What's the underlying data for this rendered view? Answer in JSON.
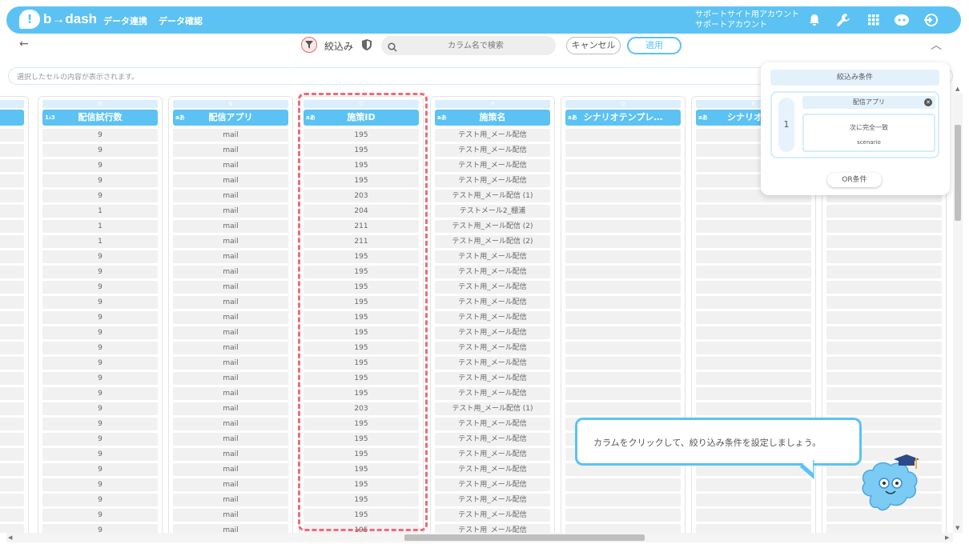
{
  "header": {
    "logo_text": "b→dash",
    "nav": [
      {
        "label": "データ連携"
      },
      {
        "label": "データ確認"
      }
    ],
    "account_line1": "サポートサイト用アカウント",
    "account_line2": "サポートアカウント"
  },
  "toolbar": {
    "back": "←",
    "filter_label": "絞込み",
    "search_placeholder": "カラム名で検索",
    "cancel_label": "キャンセル",
    "apply_label": "適用",
    "collapse": "︿"
  },
  "cellbar": {
    "text": "選択したセルの内容が表示されます。"
  },
  "columns": [
    {
      "letter": "L",
      "type": "",
      "name": "",
      "cells": [
        "",
        "",
        "",
        "",
        "",
        "",
        "",
        "",
        "",
        "",
        "",
        "",
        "",
        "",
        "",
        "",
        "",
        "",
        "",
        "",
        "",
        "",
        "",
        "",
        "",
        "",
        ""
      ]
    },
    {
      "letter": "M",
      "type": "1₂3",
      "name": "配信試行数",
      "cells": [
        "9",
        "9",
        "9",
        "9",
        "9",
        "1",
        "1",
        "1",
        "9",
        "9",
        "9",
        "9",
        "9",
        "9",
        "9",
        "9",
        "9",
        "9",
        "9",
        "9",
        "9",
        "9",
        "9",
        "9",
        "9",
        "9",
        "9"
      ]
    },
    {
      "letter": "N",
      "type": "aあ",
      "name": "配信アプリ",
      "cells": [
        "mail",
        "mail",
        "mail",
        "mail",
        "mail",
        "mail",
        "mail",
        "mail",
        "mail",
        "mail",
        "mail",
        "mail",
        "mail",
        "mail",
        "mail",
        "mail",
        "mail",
        "mail",
        "mail",
        "mail",
        "mail",
        "mail",
        "mail",
        "mail",
        "mail",
        "mail",
        "mail"
      ]
    },
    {
      "letter": "O",
      "type": "aあ",
      "name": "施策ID",
      "cells": [
        "195",
        "195",
        "195",
        "195",
        "203",
        "204",
        "211",
        "211",
        "195",
        "195",
        "195",
        "195",
        "195",
        "195",
        "195",
        "195",
        "195",
        "195",
        "203",
        "195",
        "195",
        "195",
        "195",
        "195",
        "195",
        "195",
        "195"
      ]
    },
    {
      "letter": "P",
      "type": "aあ",
      "name": "施策名",
      "cells": [
        "テスト用_メール配信",
        "テスト用_メール配信",
        "テスト用_メール配信",
        "テスト用_メール配信",
        "テスト用_メール配信 (1)",
        "テストメール2_棚浦",
        "テスト用_メール配信 (2)",
        "テスト用_メール配信 (2)",
        "テスト用_メール配信",
        "テスト用_メール配信",
        "テスト用_メール配信",
        "テスト用_メール配信",
        "テスト用_メール配信",
        "テスト用_メール配信",
        "テスト用_メール配信",
        "テスト用_メール配信",
        "テスト用_メール配信",
        "テスト用_メール配信",
        "テスト用_メール配信 (1)",
        "テスト用_メール配信",
        "テスト用_メール配信",
        "テスト用_メール配信",
        "テスト用_メール配信",
        "テスト用_メール配信",
        "テスト用_メール配信",
        "テスト用_メール配信",
        "テスト用_メール配信"
      ]
    },
    {
      "letter": "Q",
      "type": "aあ",
      "name": "シナリオテンプレ…",
      "cells": [
        "",
        "",
        "",
        "",
        "",
        "",
        "",
        "",
        "",
        "",
        "",
        "",
        "",
        "",
        "",
        "",
        "",
        "",
        "",
        "",
        "",
        "",
        "",
        "",
        "",
        "",
        ""
      ]
    },
    {
      "letter": "R",
      "type": "aあ",
      "name": "シナリオテン",
      "cells": [
        "",
        "",
        "",
        "",
        "",
        "",
        "",
        "",
        "",
        "",
        "",
        "",
        "",
        "",
        "",
        "",
        "",
        "",
        "",
        "",
        "",
        "",
        "",
        "",
        "",
        "",
        ""
      ]
    },
    {
      "letter": "S",
      "type": "",
      "name": "",
      "cells": [
        "",
        "",
        "",
        "",
        "",
        "",
        "",
        "",
        "",
        "",
        "",
        "",
        "",
        "",
        "",
        "",
        "",
        "",
        "",
        "",
        "",
        "",
        "",
        "",
        "",
        "",
        ""
      ]
    }
  ],
  "filter_panel": {
    "title": "絞込み条件",
    "group_number": "1",
    "condition_column": "配信アプリ",
    "condition_operator": "次に完全一致",
    "condition_value": "scenario",
    "or_button": "OR条件"
  },
  "tooltip": {
    "text": "カラムをクリックして、絞り込み条件を設定しましょう。"
  },
  "colors": {
    "brand": "#5bc2f3",
    "highlight": "#ef6b7a"
  }
}
